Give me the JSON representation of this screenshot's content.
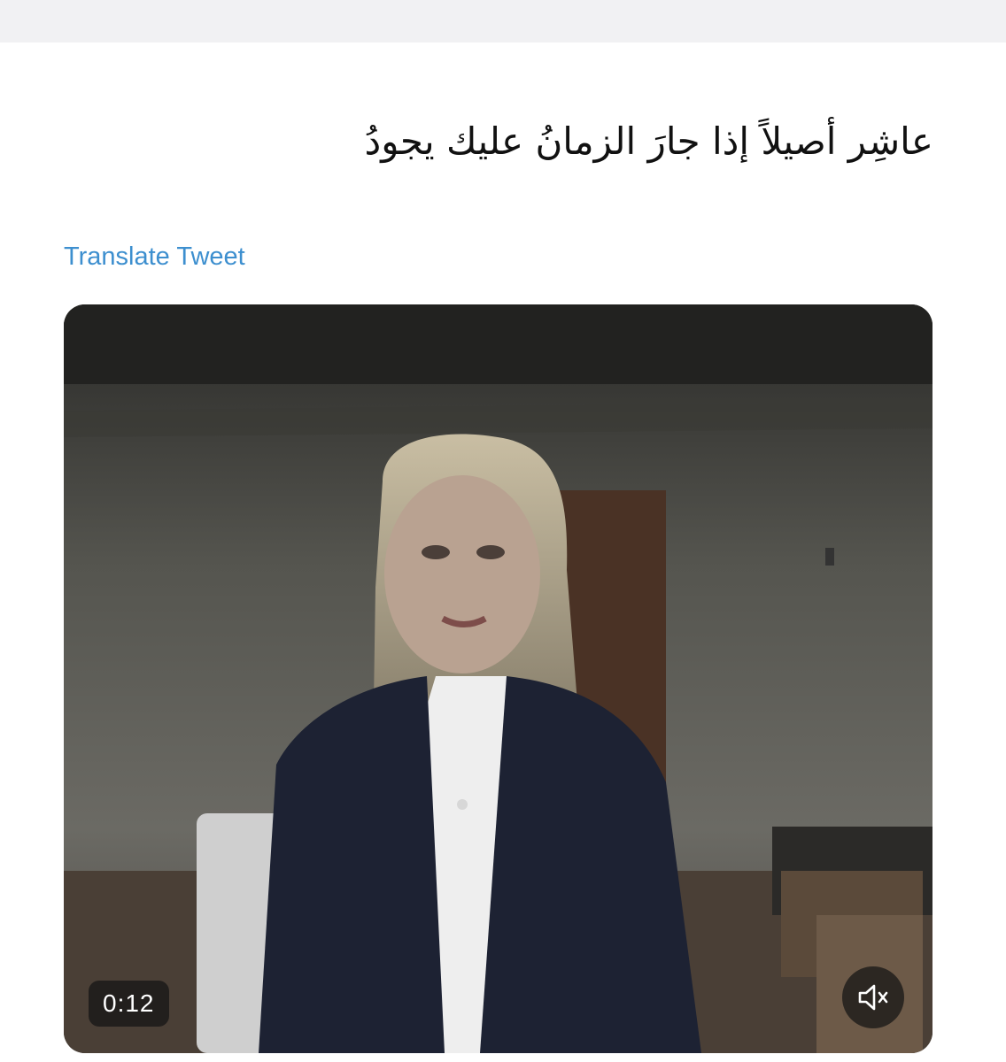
{
  "tweet": {
    "text": "عاشِر أصيلاً إذا جارَ الزمانُ عليك يجودُ",
    "translate_label": "Translate Tweet"
  },
  "video": {
    "timestamp": "0:12",
    "mute_icon": "speaker-muted-icon"
  },
  "colors": {
    "link": "#3d8fcf",
    "top_band": "#f1f1f3",
    "overlay": "#141414"
  }
}
